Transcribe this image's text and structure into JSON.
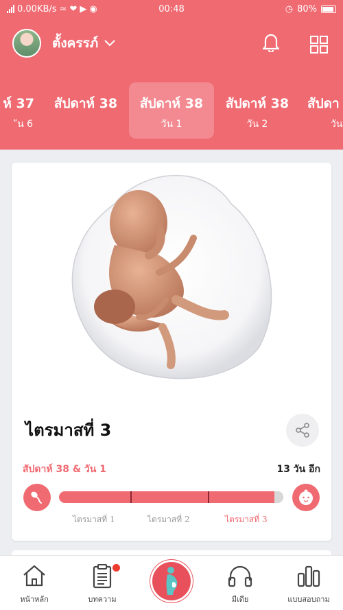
{
  "status_bar": {
    "network_speed": "0.00KB/s",
    "time": "00:48",
    "battery": "80%"
  },
  "header": {
    "profile_name": "ตั้งครรภ์",
    "icons": [
      "bell-icon",
      "grid-icon",
      "chevron-down-icon"
    ]
  },
  "weeks": [
    {
      "week": "ห์ 37",
      "day": "ัน 6"
    },
    {
      "week": "สัปดาห์ 38",
      "day": ""
    },
    {
      "week": "สัปดาห์ 38",
      "day": "วัน 1"
    },
    {
      "week": "สัปดาห์ 38",
      "day": "วัน 2"
    },
    {
      "week": "สัปดา",
      "day": "วัน"
    }
  ],
  "card": {
    "title": "ไตรมาสที่ 3",
    "week_day": "สัปดาห์ 38 & วัน 1",
    "days_left": "13 วัน อีก",
    "progress_fraction": 0.96,
    "trimesters": [
      "ไตรมาสที่ 1",
      "ไตรมาสที่ 2",
      "ไตรมาสที่ 3"
    ]
  },
  "tabs": [
    {
      "label": "หน้าหลัก",
      "icon": "home-icon"
    },
    {
      "label": "บทความ",
      "icon": "article-icon"
    },
    {
      "label": "",
      "icon": "pregnancy-icon"
    },
    {
      "label": "มีเดีย",
      "icon": "headphones-icon"
    },
    {
      "label": "แบบสอบถาม",
      "icon": "chart-icon"
    }
  ],
  "colors": {
    "brand": "#f06a72",
    "progress_rest": "#d8d8d8",
    "badge": "#ec3b2f"
  }
}
